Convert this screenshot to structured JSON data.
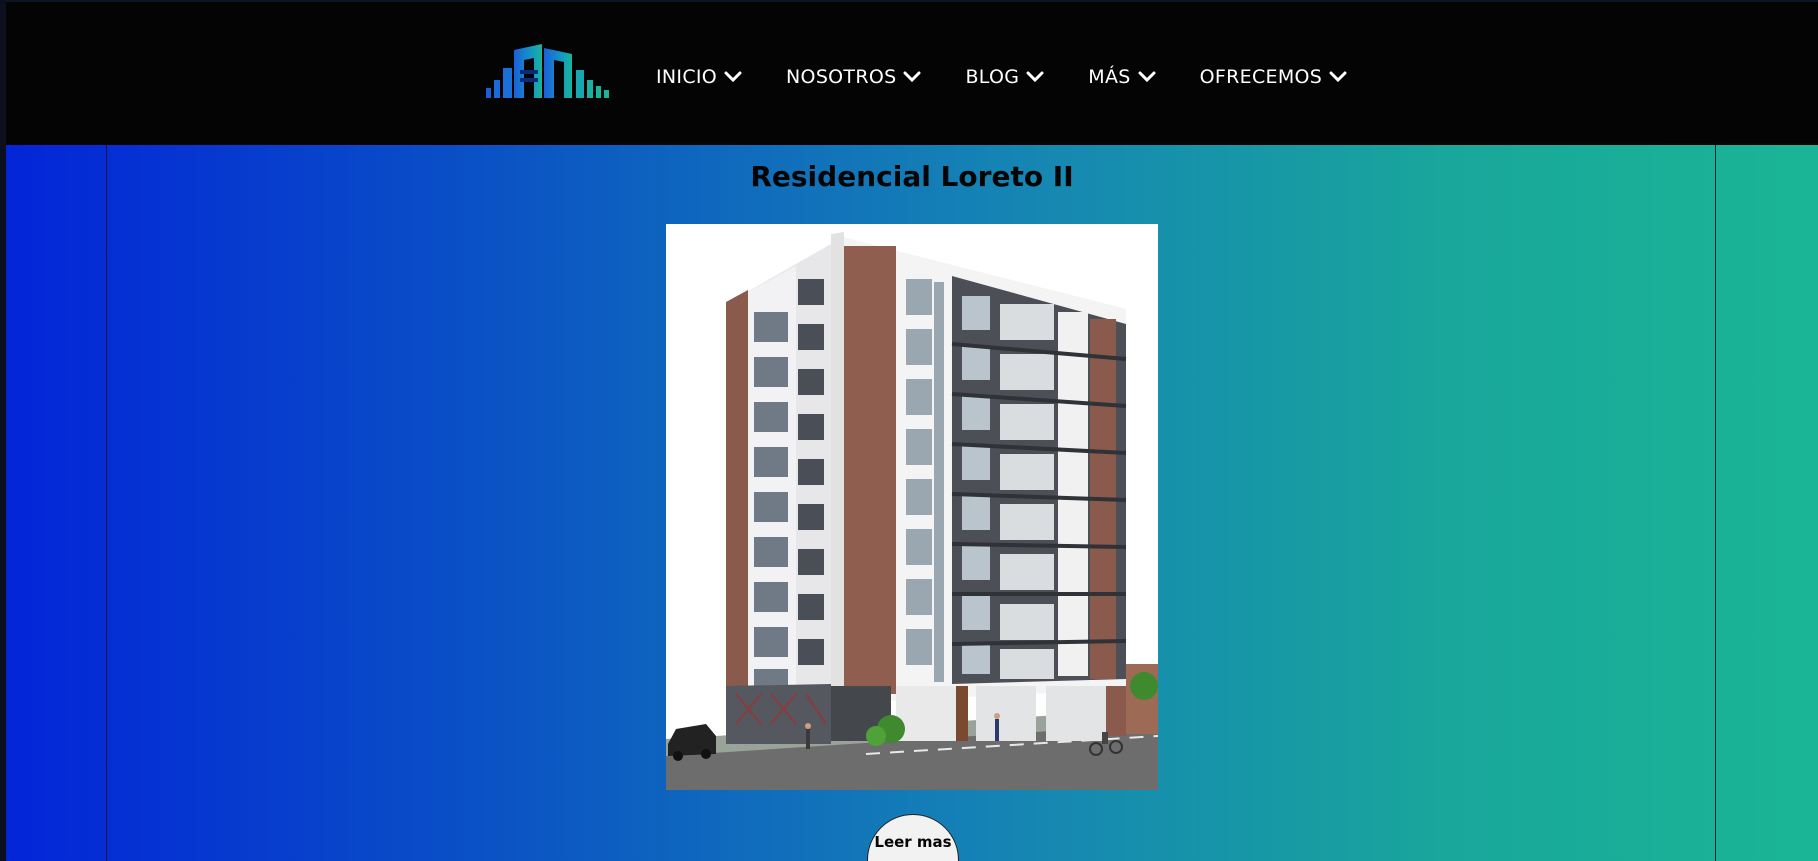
{
  "header": {
    "logo_icon": "building-logo-icon",
    "nav": [
      {
        "label": "INICIO",
        "icon": "chevron-down-icon"
      },
      {
        "label": "NOSOTROS",
        "icon": "chevron-down-icon"
      },
      {
        "label": "BLOG",
        "icon": "chevron-down-icon"
      },
      {
        "label": "MÁS",
        "icon": "chevron-down-icon"
      },
      {
        "label": "OFRECEMOS",
        "icon": "chevron-down-icon"
      }
    ]
  },
  "main": {
    "title": "Residencial Loreto II",
    "image_icon": "building-photo",
    "read_more_label": "Leer mas"
  },
  "colors": {
    "header_bg": "#040404",
    "gradient_start": "#0325d8",
    "gradient_end": "#1ab596",
    "logo_blue": "#1473d6",
    "logo_green": "#18b39a"
  }
}
